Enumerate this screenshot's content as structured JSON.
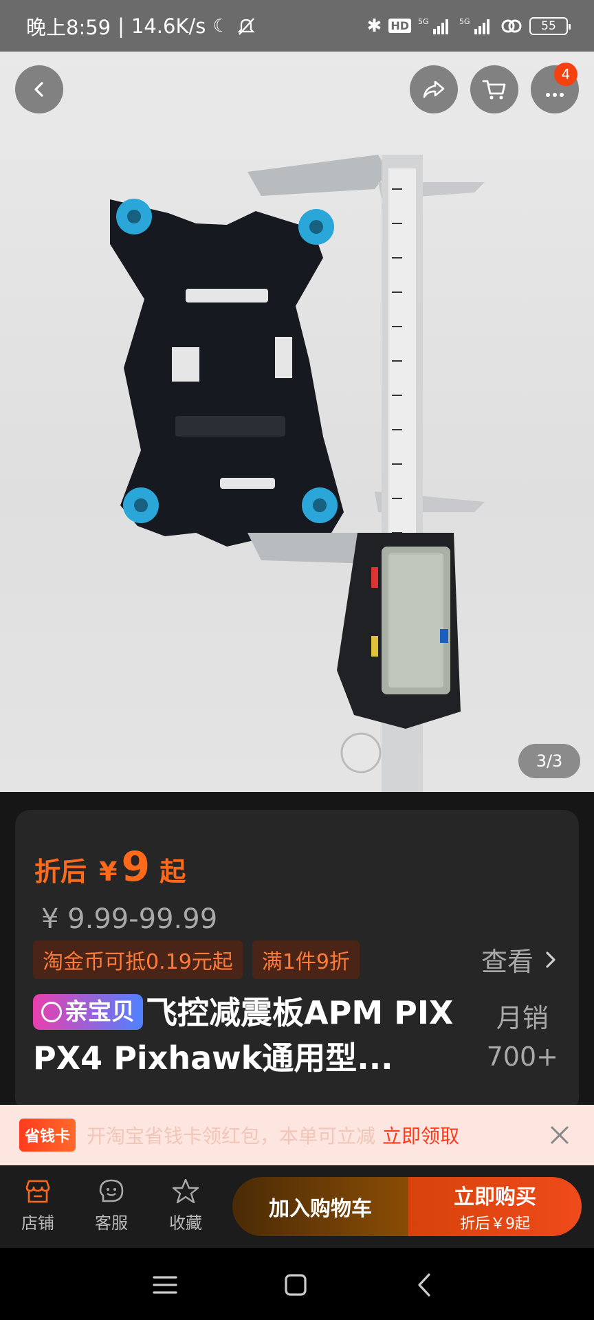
{
  "status_bar": {
    "time": "晚上8:59",
    "speed": "14.6K/s",
    "battery": "55"
  },
  "gallery": {
    "cart_badge": "4",
    "counter": "3/3"
  },
  "price": {
    "tag": "折后",
    "currency": "¥",
    "amount": "9",
    "suffix": "起",
    "original": "¥ 9.99-99.99"
  },
  "promos": [
    "淘金币可抵0.19元起",
    "满1件9折"
  ],
  "see_more": "查看",
  "product": {
    "pill_label": "亲宝贝",
    "title": "飞控减震板APM PIX PX4 Pixhawk通用型..."
  },
  "monthly_sales": {
    "label": "月销",
    "value": "700+"
  },
  "save_bar": {
    "logo": "省钱卡",
    "text": "开淘宝省钱卡领红包，本单可立减",
    "cta": "立即领取"
  },
  "action_bar": {
    "tabs": [
      "店铺",
      "客服",
      "收藏"
    ],
    "add_to_cart": "加入购物车",
    "buy_now": "立即购买",
    "buy_sub": "折后￥9起"
  },
  "colors": {
    "accent": "#ff6a1a",
    "buy": "#ef4a1b",
    "cart": "#8a4c05"
  }
}
